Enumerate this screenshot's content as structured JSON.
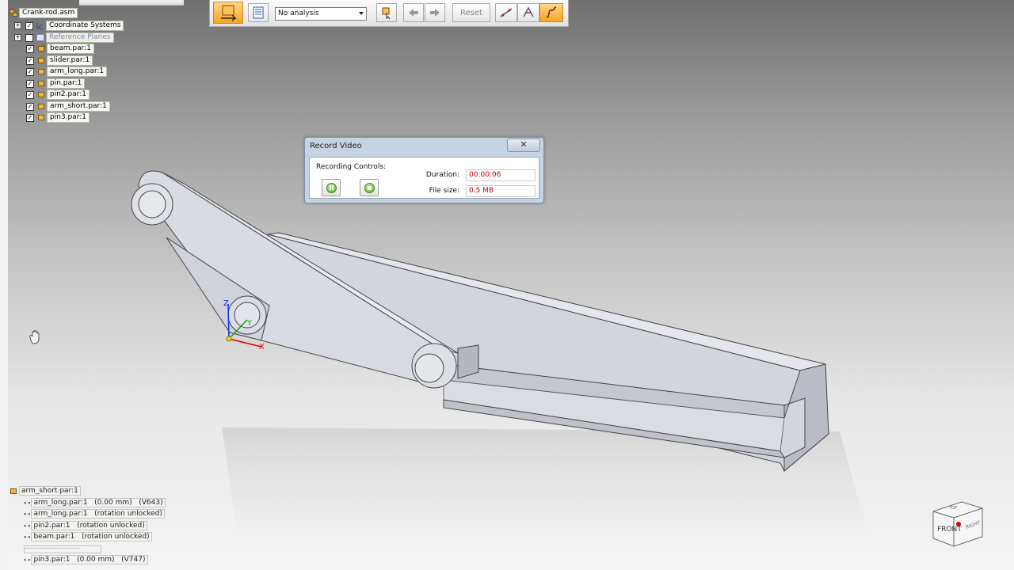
{
  "assembly_tree": {
    "root": "Crank-rod.asm",
    "items": [
      {
        "label": "Coordinate Systems",
        "checked": true,
        "expandable": true
      },
      {
        "label": "Reference Planes",
        "checked": false,
        "expandable": true
      },
      {
        "label": "beam.par:1",
        "checked": true
      },
      {
        "label": "slider.par:1",
        "checked": true
      },
      {
        "label": "arm_long.par:1",
        "checked": true
      },
      {
        "label": "pin.par:1",
        "checked": true
      },
      {
        "label": "pin2.par:1",
        "checked": true
      },
      {
        "label": "arm_short.par:1",
        "checked": true
      },
      {
        "label": "pin3.par:1",
        "checked": true
      }
    ]
  },
  "toolbar": {
    "analysis_select": "No analysis",
    "reset_label": "Reset"
  },
  "record_video": {
    "title": "Record Video",
    "close_symbol": "✕",
    "recording_controls_label": "Recording Controls:",
    "duration_label": "Duration:",
    "duration_value": "00:00:06",
    "filesize_label": "File size:",
    "filesize_value": "0.5 MB"
  },
  "relationships": {
    "header": "arm_short.par:1",
    "items": [
      {
        "part": "arm_long.par:1",
        "detail": "(0.00 mm)",
        "code": "(V643)"
      },
      {
        "part": "arm_long.par:1",
        "detail": "(rotation unlocked)",
        "code": ""
      },
      {
        "part": "pin2.par:1",
        "detail": "(rotation unlocked)",
        "code": ""
      },
      {
        "part": "beam.par:1",
        "detail": "(rotation unlocked)",
        "code": ""
      },
      {
        "part": "pin3.par:1",
        "detail": "(0.00 mm)",
        "code": "(V747)"
      }
    ],
    "separator": "----------------------------"
  },
  "triad": {
    "x": "X",
    "y": "Y",
    "z": "Z"
  },
  "view_cube": {
    "front": "FRONT",
    "top": "TOP",
    "right": "RIGHT"
  },
  "icons": {
    "assembly": "assembly-icon",
    "part": "part-icon",
    "hand": "hand-pan-icon"
  },
  "colors": {
    "active_orange": "#f5a623",
    "value_red": "#c40000",
    "part_gray": "#d0d3d9"
  }
}
